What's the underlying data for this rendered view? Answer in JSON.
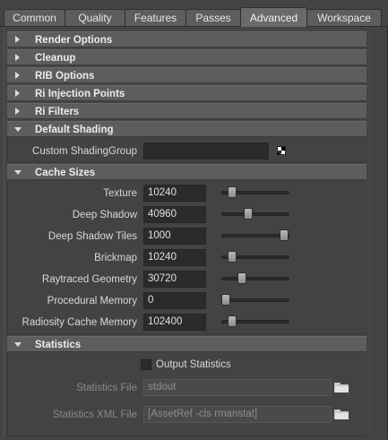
{
  "tabs": [
    "Common",
    "Quality",
    "Features",
    "Passes",
    "Advanced",
    "Workspace"
  ],
  "active_tab": "Advanced",
  "sections": {
    "render_options": "Render Options",
    "cleanup": "Cleanup",
    "rib_options": "RIB Options",
    "ri_injection_points": "Ri Injection Points",
    "ri_filters": "Ri Filters",
    "default_shading": "Default Shading",
    "cache_sizes": "Cache Sizes",
    "statistics": "Statistics"
  },
  "default_shading": {
    "custom_shading_group_label": "Custom ShadingGroup",
    "custom_shading_group_value": ""
  },
  "cache_sizes": [
    {
      "label": "Texture",
      "value": "10240",
      "slider": 0.1
    },
    {
      "label": "Deep Shadow",
      "value": "40960",
      "slider": 0.38
    },
    {
      "label": "Deep Shadow Tiles",
      "value": "1000",
      "slider": 0.99
    },
    {
      "label": "Brickmap",
      "value": "10240",
      "slider": 0.1
    },
    {
      "label": "Raytraced Geometry",
      "value": "30720",
      "slider": 0.28
    },
    {
      "label": "Procedural Memory",
      "value": "0",
      "slider": 0.0
    },
    {
      "label": "Radiosity Cache Memory",
      "value": "102400",
      "slider": 0.1
    }
  ],
  "statistics": {
    "output_statistics_label": "Output Statistics",
    "output_statistics_checked": false,
    "statistics_file_label": "Statistics File",
    "statistics_file_value": "stdout",
    "statistics_xml_file_label": "Statistics XML File",
    "statistics_xml_file_value": "[AssetRef -cls rmanstat]"
  },
  "icons": {
    "collapsed": "triangle-right-icon",
    "expanded": "triangle-down-icon",
    "shading_group": "checker-icon",
    "browse": "folder-icon"
  }
}
